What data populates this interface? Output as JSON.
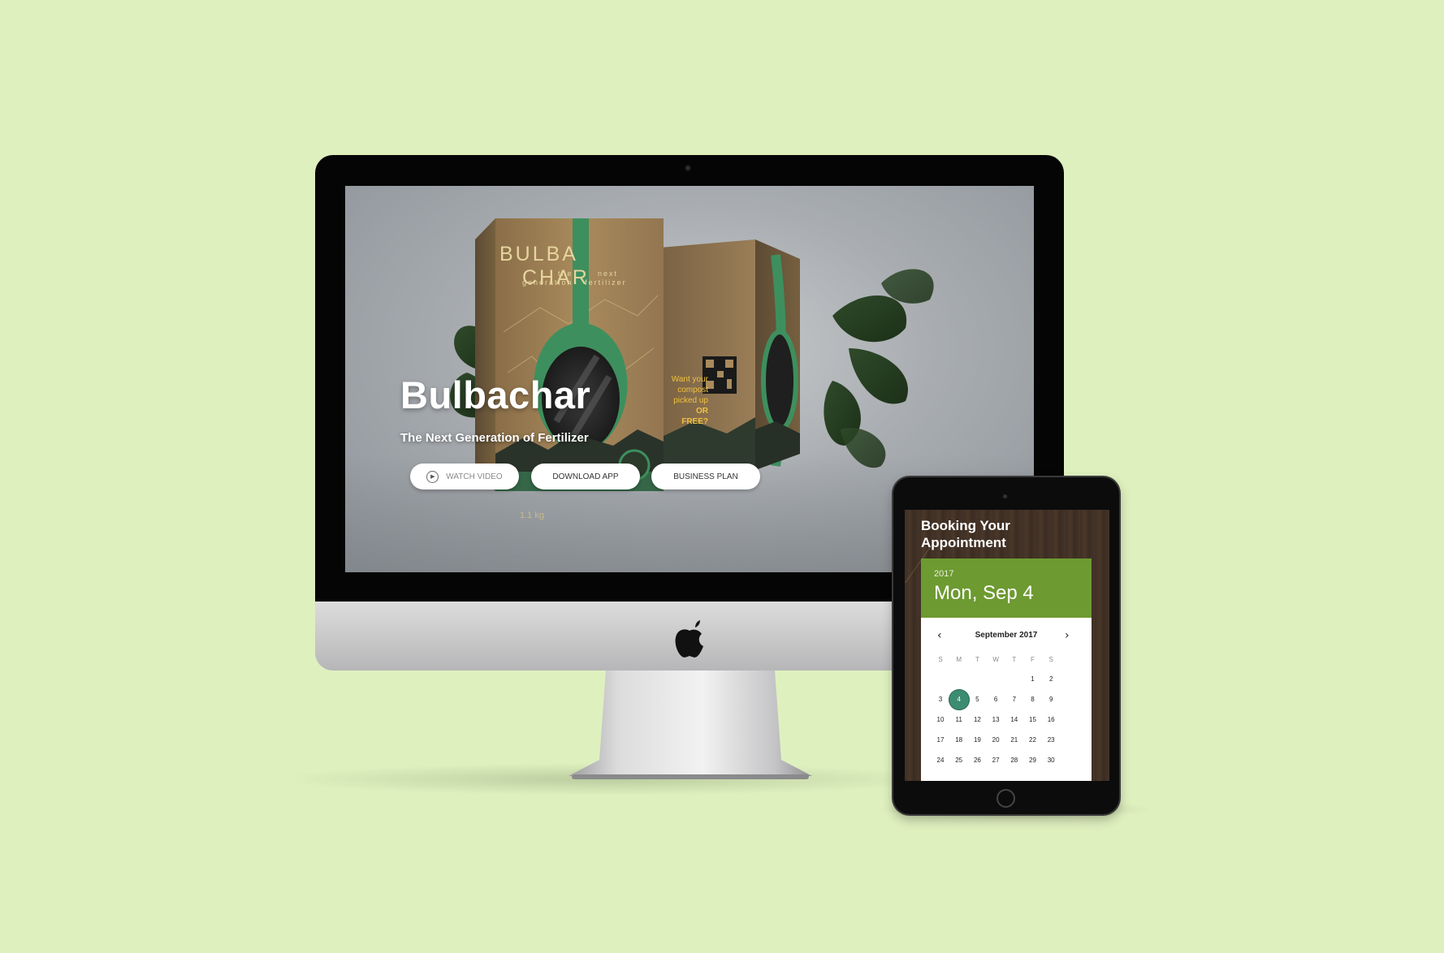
{
  "website": {
    "title": "Bulbachar",
    "subtitle": "The Next Generation of Fertilizer",
    "buttons": {
      "watch_video": "WATCH VIDEO",
      "download_app": "DOWNLOAD APP",
      "business_plan": "BUSINESS PLAN"
    },
    "package": {
      "brand_left": "BULBA",
      "brand_right": "CHAR",
      "tagline_left": "the",
      "tagline_right": "next",
      "tagline2_left": "generation",
      "tagline2_right": "fertilizer",
      "weight": "1.1 kg",
      "promo_lines": [
        "Want your",
        "compost",
        "picked up",
        "OR FREE?"
      ]
    }
  },
  "tablet": {
    "heading_line1": "Booking Your",
    "heading_line2": "Appointment",
    "picker": {
      "year": "2017",
      "date": "Mon, Sep 4",
      "month": "September 2017",
      "weekdays": [
        "S",
        "M",
        "T",
        "W",
        "T",
        "F",
        "S"
      ],
      "weeks": [
        [
          "",
          "",
          "",
          "",
          "",
          "1",
          "2"
        ],
        [
          "3",
          "4",
          "5",
          "6",
          "7",
          "8",
          "9"
        ],
        [
          "10",
          "11",
          "12",
          "13",
          "14",
          "15",
          "16"
        ],
        [
          "17",
          "18",
          "19",
          "20",
          "21",
          "22",
          "23"
        ],
        [
          "24",
          "25",
          "26",
          "27",
          "28",
          "29",
          "30"
        ]
      ],
      "selected_day": "4"
    }
  },
  "icons": {
    "play": "play-icon",
    "prev": "chevron-left-icon",
    "next": "chevron-right-icon",
    "apple": "apple-logo-icon"
  },
  "colors": {
    "background": "#dff0bf",
    "picker_header": "#6d9a31",
    "selected_day": "#3c8c72",
    "package_green": "#3e8f5e"
  }
}
